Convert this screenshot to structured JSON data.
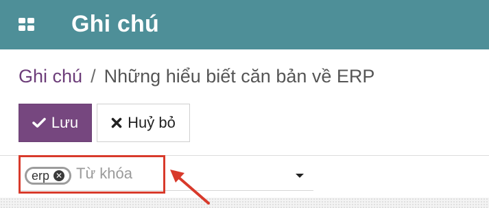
{
  "header": {
    "app_title": "Ghi chú",
    "apps_icon": "grid-icon",
    "background": "#4e8f98"
  },
  "breadcrumb": {
    "parent": "Ghi chú",
    "separator": "/",
    "current": "Những hiểu biết căn bản về ERP"
  },
  "toolbar": {
    "save_label": "Lưu",
    "save_icon": "check-icon",
    "discard_label": "Huỷ bỏ",
    "discard_icon": "x-icon",
    "save_color": "#76477f"
  },
  "tags_field": {
    "tags": [
      {
        "label": "erp"
      }
    ],
    "placeholder": "Từ khóa"
  },
  "annotation": {
    "highlight_color": "#d83a2b"
  }
}
